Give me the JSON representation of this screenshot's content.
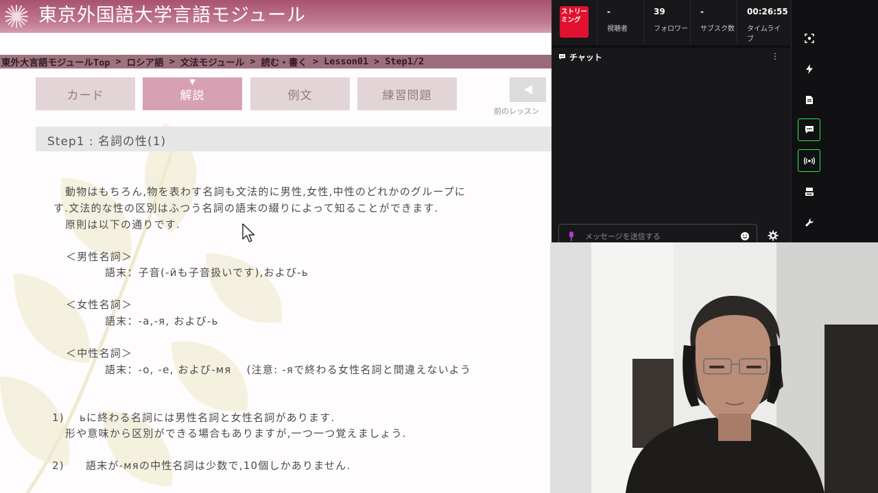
{
  "site": {
    "title": "東京外国語大学言語モジュール"
  },
  "breadcrumb": [
    "東外大言語モジュールTop",
    "ロシア語",
    "文法モジュール",
    "読む・書く",
    "Lesson01",
    "Step1/2"
  ],
  "breadcrumb_separator": ">",
  "tabs": [
    {
      "label": "カード",
      "active": false
    },
    {
      "label": "解説",
      "active": true
    },
    {
      "label": "例文",
      "active": false
    },
    {
      "label": "練習問題",
      "active": false
    }
  ],
  "active_tab_marker": "▼",
  "prev_lesson": {
    "arrow": "◀",
    "label": "前のレッスン"
  },
  "step_title": "Step1 : 名詞の性(1)",
  "content": {
    "intro_line1": "動物はもちろん,物を表わす名詞も文法的に男性,女性,中性のどれかのグループに",
    "intro_line2": "す.文法的な性の区別はふつう名詞の語末の綴りによって知ることができます.",
    "intro_line3": "原則は以下の通りです.",
    "masculine_heading": "＜男性名詞＞",
    "masculine_rule": "語末：子音(-йも子音扱いです),および-ь",
    "feminine_heading": "＜女性名詞＞",
    "feminine_rule": "語末：-а,-я, および-ь",
    "neuter_heading": "＜中性名詞＞",
    "neuter_rule": "語末：-о, -е, および-мя　 (注意: -яで終わる女性名詞と間違えないよう",
    "note1_number": "1)",
    "note1_line1": "ьに終わる名詞には男性名詞と女性名詞があります.",
    "note1_line2": "形や意味から区別ができる場合もありますが,一つ一つ覚えましょう.",
    "note2_number": "2)",
    "note2_line1": "語末が-мяの中性名詞は少数で,10個しかありません."
  },
  "stream": {
    "status_badge": "ストリーミング",
    "stats": [
      {
        "value": "-",
        "label": "視聴者"
      },
      {
        "value": "39",
        "label": "フォロワー"
      },
      {
        "value": "-",
        "label": "サブスク数"
      },
      {
        "value": "00:26:55",
        "label": "タイムライブ"
      }
    ],
    "status_color": "#e0122f",
    "highlight_color": "#2ee84e"
  },
  "chat": {
    "title": "チャット",
    "menu": "⋮",
    "input_placeholder": "メッセージを送信する"
  },
  "rail_icons": [
    "screenshot-icon",
    "lightning-icon",
    "document-icon",
    "chat-bubble-icon",
    "broadcast-icon",
    "layout-icon",
    "wrench-icon"
  ]
}
